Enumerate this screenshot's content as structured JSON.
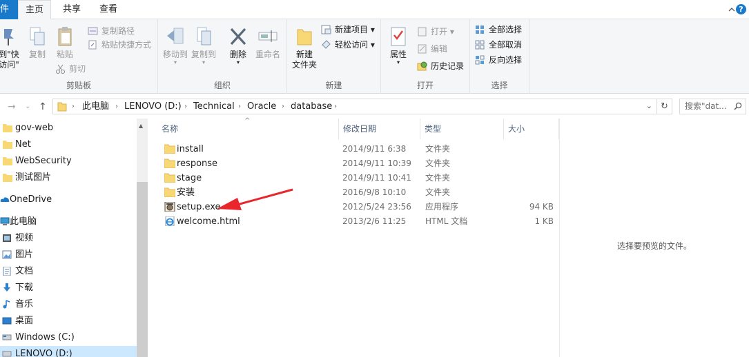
{
  "tabs": {
    "file": "件",
    "home": "主页",
    "share": "共享",
    "view": "查看"
  },
  "ribbon": {
    "clipboard": {
      "pin_label_1": "到\"快",
      "pin_label_2": "访问\"",
      "copy": "复制",
      "paste": "粘贴",
      "copy_path": "复制路径",
      "paste_shortcut": "粘贴快捷方式",
      "cut": "剪切",
      "group": "剪贴板"
    },
    "organize": {
      "move_to": "移动到",
      "copy_to": "复制到",
      "delete": "删除",
      "rename": "重命名",
      "group": "组织"
    },
    "new": {
      "new_folder_1": "新建",
      "new_folder_2": "文件夹",
      "new_item": "新建项目",
      "easy_access": "轻松访问",
      "group": "新建"
    },
    "open": {
      "properties": "属性",
      "open": "打开",
      "edit": "编辑",
      "history": "历史记录",
      "group": "打开"
    },
    "select": {
      "select_all": "全部选择",
      "select_none": "全部取消",
      "invert": "反向选择",
      "group": "选择"
    }
  },
  "address": {
    "crumbs": [
      "此电脑",
      "LENOVO (D:)",
      "Technical",
      "Oracle",
      "database"
    ],
    "search_placeholder": "搜索\"dat..."
  },
  "nav": {
    "items": [
      "gov-web",
      "Net",
      "WebSecurity",
      "测试图片",
      "OneDrive",
      "此电脑",
      "视频",
      "图片",
      "文档",
      "下载",
      "音乐",
      "桌面",
      "Windows (C:)",
      "LENOVO (D:)"
    ]
  },
  "columns": {
    "name": "名称",
    "date": "修改日期",
    "type": "类型",
    "size": "大小"
  },
  "files": [
    {
      "name": "install",
      "date": "2014/9/11 6:38",
      "type": "文件夹",
      "size": "",
      "icon": "folder-icon"
    },
    {
      "name": "response",
      "date": "2014/9/11 10:39",
      "type": "文件夹",
      "size": "",
      "icon": "folder-icon"
    },
    {
      "name": "stage",
      "date": "2014/9/11 10:41",
      "type": "文件夹",
      "size": "",
      "icon": "folder-icon"
    },
    {
      "name": "安装",
      "date": "2016/9/8 10:10",
      "type": "文件夹",
      "size": "",
      "icon": "folder-icon"
    },
    {
      "name": "setup.exe",
      "date": "2012/5/24 23:56",
      "type": "应用程序",
      "size": "94 KB",
      "icon": "exe-icon"
    },
    {
      "name": "welcome.html",
      "date": "2013/2/6 11:25",
      "type": "HTML 文档",
      "size": "1 KB",
      "icon": "ie-html-icon"
    }
  ],
  "preview": {
    "text": "选择要预览的文件。"
  },
  "colors": {
    "accent": "#1979ca",
    "folder": "#f8d775",
    "annotation_arrow": "#e8262b"
  }
}
